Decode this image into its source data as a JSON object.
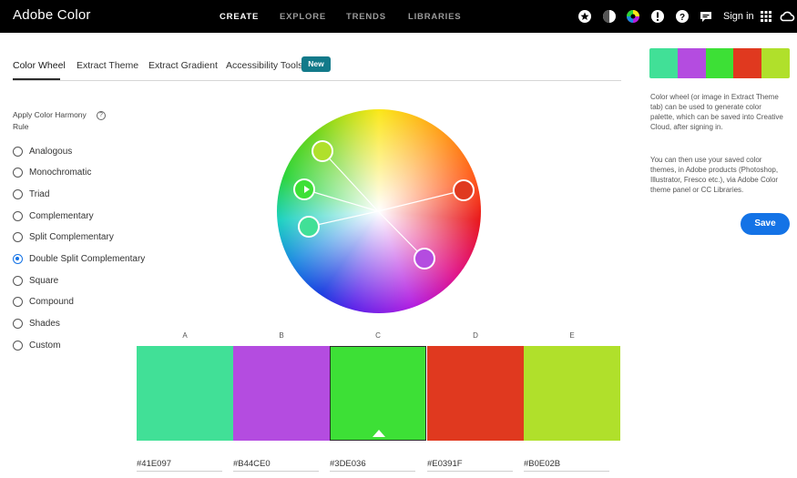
{
  "app": {
    "title": "Adobe Color"
  },
  "nav": {
    "create": "CREATE",
    "explore": "EXPLORE",
    "trends": "TRENDS",
    "libraries": "LIBRARIES"
  },
  "topbar": {
    "icons": [
      "star-icon",
      "contrast-icon",
      "color-wheel-icon",
      "alert-icon",
      "help-icon",
      "chat-icon",
      "apps-grid-icon",
      "creative-cloud-icon"
    ],
    "sign_in": "Sign in"
  },
  "tabs": [
    {
      "label": "Color Wheel",
      "active": true
    },
    {
      "label": "Extract Theme"
    },
    {
      "label": "Extract Gradient"
    },
    {
      "label": "Accessibility Tools"
    }
  ],
  "new_badge": "New",
  "harmony": {
    "title": "Apply Color Harmony Rule",
    "help": "?",
    "options": [
      "Analogous",
      "Monochromatic",
      "Triad",
      "Complementary",
      "Split Complementary",
      "Double Split Complementary",
      "Square",
      "Compound",
      "Shades",
      "Custom"
    ],
    "selected_index": 5
  },
  "swatches": [
    {
      "label": "A",
      "hex": "#41E097",
      "color": "#41E097"
    },
    {
      "label": "B",
      "hex": "#B44CE0",
      "color": "#B44CE0"
    },
    {
      "label": "C",
      "hex": "#3DE036",
      "color": "#3DE036"
    },
    {
      "label": "D",
      "hex": "#E0391F",
      "color": "#E0391F"
    },
    {
      "label": "E",
      "hex": "#B0E02B",
      "color": "#B0E02B"
    }
  ],
  "selected_swatch": 2,
  "info": {
    "para1": "Color wheel (or image in Extract Theme tab) can be used to generate color palette, which can be saved into Creative Cloud, after signing in.",
    "para2": "You can then use your saved color themes, in Adobe products (Photoshop, Illustrator, Fresco etc.), via Adobe Color theme panel or CC Libraries."
  },
  "save_label": "Save",
  "colors": {
    "accent": "#1473e6",
    "badge": "#127a8a",
    "topbar": "#000000"
  }
}
